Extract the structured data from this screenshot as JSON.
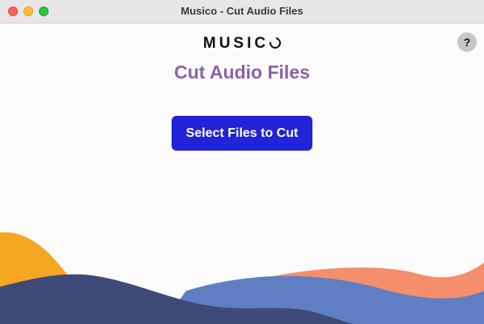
{
  "window": {
    "title": "Musico - Cut Audio Files"
  },
  "app": {
    "logo_text": "MUSIC",
    "logo_last_letter": "O",
    "heading": "Cut Audio Files",
    "help_label": "?",
    "primary_button_label": "Select Files to Cut"
  },
  "colors": {
    "heading": "#8c62a5",
    "button": "#2222d8",
    "wave_orange": "#f5a623",
    "wave_salmon": "#f48e6c",
    "wave_navy": "#3e4a78",
    "wave_blue": "#5f7fc2"
  },
  "icons": {
    "close": "traffic-light-close",
    "minimize": "traffic-light-minimize",
    "maximize": "traffic-light-maximize",
    "help": "question-mark-icon"
  }
}
